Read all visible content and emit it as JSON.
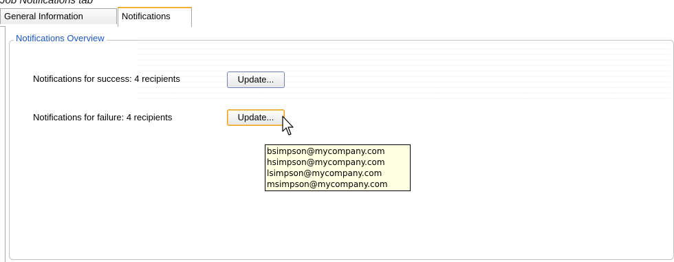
{
  "caption": "Job Notifications tab",
  "tabs": [
    {
      "label": "General Information",
      "active": false
    },
    {
      "label": "Notifications",
      "active": true
    }
  ],
  "section": {
    "legend": "Notifications Overview"
  },
  "rows": {
    "success": {
      "label": "Notifications for success: 4 recipients",
      "button": "Update..."
    },
    "failure": {
      "label": "Notifications for failure: 4 recipients",
      "button": "Update..."
    }
  },
  "tooltip": {
    "recipients": [
      "bsimpson@mycompany.com",
      "hsimpson@mycompany.com",
      "lsimpson@mycompany.com",
      "msimpson@mycompany.com"
    ]
  },
  "colors": {
    "accent": "#f0b030",
    "legend_text": "#1c56c4",
    "tooltip_bg": "#ffffe1"
  },
  "icons": {
    "cursor": "mouse-pointer-icon"
  }
}
